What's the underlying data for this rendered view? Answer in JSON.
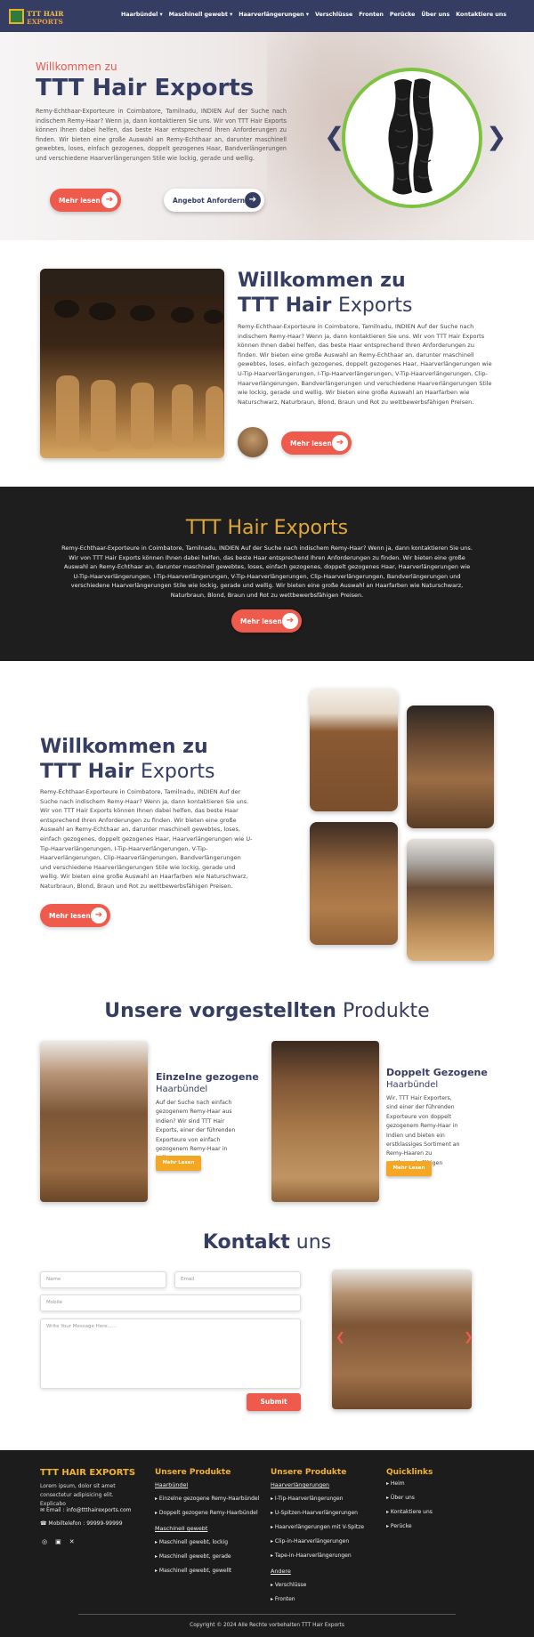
{
  "nav": {
    "logo_line1": "TTT HAIR",
    "logo_line2": "EXPORTS",
    "items": [
      "Haarbündel ▾",
      "Maschinell gewebt ▾",
      "Haarverlängerungen ▾",
      "Verschlüsse",
      "Fronten",
      "Perücke",
      "Über uns",
      "Kontaktiere uns"
    ]
  },
  "hero": {
    "welcome": "Willkommen zu",
    "title": "TTT Hair Exports",
    "description": "Remy-Echthaar-Exporteure in Coimbatore, Tamilnadu, INDIEN Auf der Suche nach indischem Remy-Haar? Wenn ja, dann kontaktieren Sie uns. Wir von TTT Hair Exports können Ihnen dabei helfen, das beste Haar entsprechend Ihren Anforderungen zu finden. Wir bieten eine große Auswahl an Remy-Echthaar an, darunter maschinell gewebtes, loses, einfach gezogenes, doppelt gezogenes Haar, Bandverlängerungen und verschiedene Haarverlängerungen Stile wie lockig, gerade und wellig.",
    "btn_more": "Mehr lesen",
    "btn_quote": "Angebot Anfordern",
    "prev": "❮",
    "next": "❯"
  },
  "about": {
    "title_line1": "Willkommen zu",
    "title_bold": "TTT Hair",
    "title_light": "Exports",
    "text": "Remy-Echthaar-Exporteure in Coimbatore, Tamilnadu, INDIEN Auf der Suche nach indischem Remy-Haar? Wenn ja, dann kontaktieren Sie uns. Wir von TTT Hair Exports können Ihnen dabei helfen, das beste Haar entsprechend Ihren Anforderungen zu finden. Wir bieten eine große Auswahl an Remy-Echthaar an, darunter maschinell gewebtes, loses, einfach gezogenes, doppelt gezogenes Haar, Haarverlängerungen wie U-Tip-Haarverlängerungen, I-Tip-Haarverlängerungen, V-Tip-Haarverlängerungen, Clip-Haarverlängerungen, Bandverlängerungen und verschiedene Haarverlängerungen Stile wie lockig, gerade und wellig. Wir bieten eine große Auswahl an Haarfarben wie Naturschwarz, Naturbraun, Blond, Braun und Rot zu wettbewerbsfähigen Preisen.",
    "btn": "Mehr lesen"
  },
  "band": {
    "title": "TTT Hair Exports",
    "text": "Remy-Echthaar-Exporteure in Coimbatore, Tamilnadu, INDIEN Auf der Suche nach indischem Remy-Haar? Wenn ja, dann kontaktieren Sie uns. Wir von TTT Hair Exports können Ihnen dabei helfen, das beste Haar entsprechend Ihren Anforderungen zu finden. Wir bieten eine große Auswahl an Remy-Echthaar an, darunter maschinell gewebtes, loses, einfach gezogenes, doppelt gezogenes Haar, Haarverlängerungen wie U-Tip-Haarverlängerungen, I-Tip-Haarverlängerungen, V-Tip-Haarverlängerungen, Clip-Haarverlängerungen, Bandverlängerungen und verschiedene Haarverlängerungen Stile wie lockig, gerade und wellig. Wir bieten eine große Auswahl an Haarfarben wie Naturschwarz, Naturbraun, Blond, Braun und Rot zu wettbewerbsfähigen Preisen.",
    "btn": "Mehr lesen"
  },
  "about2": {
    "title_line1": "Willkommen zu",
    "title_bold": "TTT Hair",
    "title_light": "Exports",
    "text": "Remy-Echthaar-Exporteure in Coimbatore, Tamilnadu, INDIEN Auf der Suche nach indischem Remy-Haar? Wenn ja, dann kontaktieren Sie uns. Wir von TTT Hair Exports können Ihnen dabei helfen, das beste Haar entsprechend Ihren Anforderungen zu finden. Wir bieten eine große Auswahl an Remy-Echthaar an, darunter maschinell gewebtes, loses, einfach gezogenes, doppelt gezogenes Haar, Haarverlängerungen wie U-Tip-Haarverlängerungen, I-Tip-Haarverlängerungen, V-Tip-Haarverlängerungen, Clip-Haarverlängerungen, Bandverlängerungen und verschiedene Haarverlängerungen Stile wie lockig, gerade und wellig. Wir bieten eine große Auswahl an Haarfarben wie Naturschwarz, Naturbraun, Blond, Braun und Rot zu wettbewerbsfähigen Preisen.",
    "btn": "Mehr lesen"
  },
  "products": {
    "title_bold": "Unsere vorgestellten",
    "title_light": "Produkte",
    "items": [
      {
        "title": "Einzelne gezogene",
        "subtitle": "Haarbündel",
        "text": "Auf der Suche nach einfach gezogenem Remy-Haar aus Indien? Wir sind TTT Hair Exports, einer der führenden Exporteure von einfach gezogenem Remy-Haar in Indien.",
        "btn": "Mehr Lesen"
      },
      {
        "title": "Doppelt Gezogene",
        "subtitle": "Haarbündel",
        "text": "Wir, TTT Hair Exporters, sind einer der führenden Exporteure von doppelt gezogenem Remy-Haar in Indien und bieten ein erstklassiges Sortiment an Remy-Haaren zu wettbewerbsfähigen Preisen.",
        "btn": "Mehr Lesen"
      }
    ]
  },
  "contact": {
    "title_bold": "Kontakt",
    "title_light": "uns",
    "name_ph": "Name",
    "email_ph": "Email",
    "mobile_ph": "Mobile",
    "message_ph": "Write Your Message Here......",
    "submit": "Submit",
    "prev": "❮",
    "next": "❯"
  },
  "footer": {
    "brand": "TTT HAIR EXPORTS",
    "about": "Lorem ipsum, dolor sit amet consectetur adipisicing elit. Explicabo",
    "email": "Email : info@ttthairexports.com",
    "phone": "Mobiltelefon : 99999-99999",
    "col1_title": "Unsere Produkte",
    "col1_sub1": "Haarbündel",
    "col1_sub1_items": [
      "Einzelne gezogene Remy-Haarbündel",
      "Doppelt gezogene Remy-Haarbündel"
    ],
    "col1_sub2": "Maschinell gewebt",
    "col1_sub2_items": [
      "Maschinell gewebt, lockig",
      "Maschinell gewebt, gerade",
      "Maschinell gewebt, gewellt"
    ],
    "col2_title": "Unsere Produkte",
    "col2_sub1": "Haarverlängerungen",
    "col2_sub1_items": [
      "I-Tip-Haarverlängerungen",
      "U-Spitzen-Haarverlängerungen",
      "Haarverlängerungen mit V-Spitze",
      "Clip-in-Haarverlängerungen",
      "Tape-in-Haarverlängerungen"
    ],
    "col2_sub2": "Andere",
    "col2_sub2_items": [
      "Verschlüsse",
      "Fronten"
    ],
    "col3_title": "Quicklinks",
    "col3_items": [
      "Heim",
      "Über uns",
      "Kontaktiere uns",
      "Perücke"
    ],
    "copyright": "Copyright © 2024 Alle Rechte vorbehalten TTT Hair Exports"
  }
}
